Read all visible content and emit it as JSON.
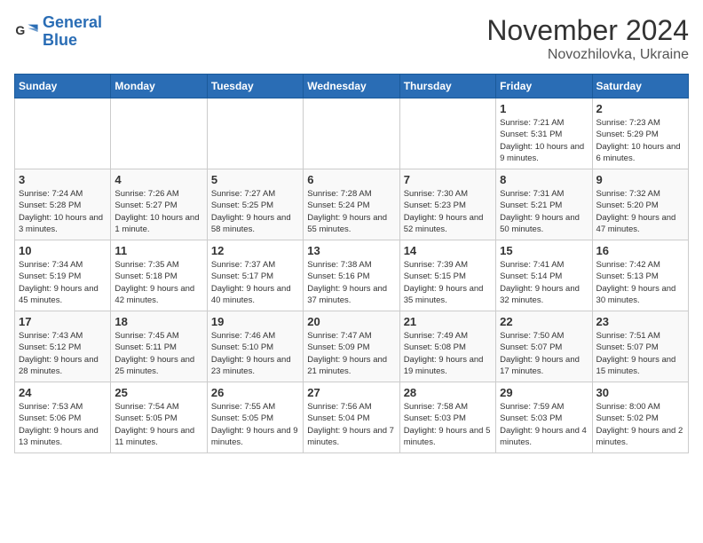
{
  "logo": {
    "line1": "General",
    "line2": "Blue"
  },
  "header": {
    "month": "November 2024",
    "location": "Novozhilovka, Ukraine"
  },
  "weekdays": [
    "Sunday",
    "Monday",
    "Tuesday",
    "Wednesday",
    "Thursday",
    "Friday",
    "Saturday"
  ],
  "weeks": [
    [
      {
        "day": "",
        "info": ""
      },
      {
        "day": "",
        "info": ""
      },
      {
        "day": "",
        "info": ""
      },
      {
        "day": "",
        "info": ""
      },
      {
        "day": "",
        "info": ""
      },
      {
        "day": "1",
        "info": "Sunrise: 7:21 AM\nSunset: 5:31 PM\nDaylight: 10 hours and 9 minutes."
      },
      {
        "day": "2",
        "info": "Sunrise: 7:23 AM\nSunset: 5:29 PM\nDaylight: 10 hours and 6 minutes."
      }
    ],
    [
      {
        "day": "3",
        "info": "Sunrise: 7:24 AM\nSunset: 5:28 PM\nDaylight: 10 hours and 3 minutes."
      },
      {
        "day": "4",
        "info": "Sunrise: 7:26 AM\nSunset: 5:27 PM\nDaylight: 10 hours and 1 minute."
      },
      {
        "day": "5",
        "info": "Sunrise: 7:27 AM\nSunset: 5:25 PM\nDaylight: 9 hours and 58 minutes."
      },
      {
        "day": "6",
        "info": "Sunrise: 7:28 AM\nSunset: 5:24 PM\nDaylight: 9 hours and 55 minutes."
      },
      {
        "day": "7",
        "info": "Sunrise: 7:30 AM\nSunset: 5:23 PM\nDaylight: 9 hours and 52 minutes."
      },
      {
        "day": "8",
        "info": "Sunrise: 7:31 AM\nSunset: 5:21 PM\nDaylight: 9 hours and 50 minutes."
      },
      {
        "day": "9",
        "info": "Sunrise: 7:32 AM\nSunset: 5:20 PM\nDaylight: 9 hours and 47 minutes."
      }
    ],
    [
      {
        "day": "10",
        "info": "Sunrise: 7:34 AM\nSunset: 5:19 PM\nDaylight: 9 hours and 45 minutes."
      },
      {
        "day": "11",
        "info": "Sunrise: 7:35 AM\nSunset: 5:18 PM\nDaylight: 9 hours and 42 minutes."
      },
      {
        "day": "12",
        "info": "Sunrise: 7:37 AM\nSunset: 5:17 PM\nDaylight: 9 hours and 40 minutes."
      },
      {
        "day": "13",
        "info": "Sunrise: 7:38 AM\nSunset: 5:16 PM\nDaylight: 9 hours and 37 minutes."
      },
      {
        "day": "14",
        "info": "Sunrise: 7:39 AM\nSunset: 5:15 PM\nDaylight: 9 hours and 35 minutes."
      },
      {
        "day": "15",
        "info": "Sunrise: 7:41 AM\nSunset: 5:14 PM\nDaylight: 9 hours and 32 minutes."
      },
      {
        "day": "16",
        "info": "Sunrise: 7:42 AM\nSunset: 5:13 PM\nDaylight: 9 hours and 30 minutes."
      }
    ],
    [
      {
        "day": "17",
        "info": "Sunrise: 7:43 AM\nSunset: 5:12 PM\nDaylight: 9 hours and 28 minutes."
      },
      {
        "day": "18",
        "info": "Sunrise: 7:45 AM\nSunset: 5:11 PM\nDaylight: 9 hours and 25 minutes."
      },
      {
        "day": "19",
        "info": "Sunrise: 7:46 AM\nSunset: 5:10 PM\nDaylight: 9 hours and 23 minutes."
      },
      {
        "day": "20",
        "info": "Sunrise: 7:47 AM\nSunset: 5:09 PM\nDaylight: 9 hours and 21 minutes."
      },
      {
        "day": "21",
        "info": "Sunrise: 7:49 AM\nSunset: 5:08 PM\nDaylight: 9 hours and 19 minutes."
      },
      {
        "day": "22",
        "info": "Sunrise: 7:50 AM\nSunset: 5:07 PM\nDaylight: 9 hours and 17 minutes."
      },
      {
        "day": "23",
        "info": "Sunrise: 7:51 AM\nSunset: 5:07 PM\nDaylight: 9 hours and 15 minutes."
      }
    ],
    [
      {
        "day": "24",
        "info": "Sunrise: 7:53 AM\nSunset: 5:06 PM\nDaylight: 9 hours and 13 minutes."
      },
      {
        "day": "25",
        "info": "Sunrise: 7:54 AM\nSunset: 5:05 PM\nDaylight: 9 hours and 11 minutes."
      },
      {
        "day": "26",
        "info": "Sunrise: 7:55 AM\nSunset: 5:05 PM\nDaylight: 9 hours and 9 minutes."
      },
      {
        "day": "27",
        "info": "Sunrise: 7:56 AM\nSunset: 5:04 PM\nDaylight: 9 hours and 7 minutes."
      },
      {
        "day": "28",
        "info": "Sunrise: 7:58 AM\nSunset: 5:03 PM\nDaylight: 9 hours and 5 minutes."
      },
      {
        "day": "29",
        "info": "Sunrise: 7:59 AM\nSunset: 5:03 PM\nDaylight: 9 hours and 4 minutes."
      },
      {
        "day": "30",
        "info": "Sunrise: 8:00 AM\nSunset: 5:02 PM\nDaylight: 9 hours and 2 minutes."
      }
    ]
  ]
}
